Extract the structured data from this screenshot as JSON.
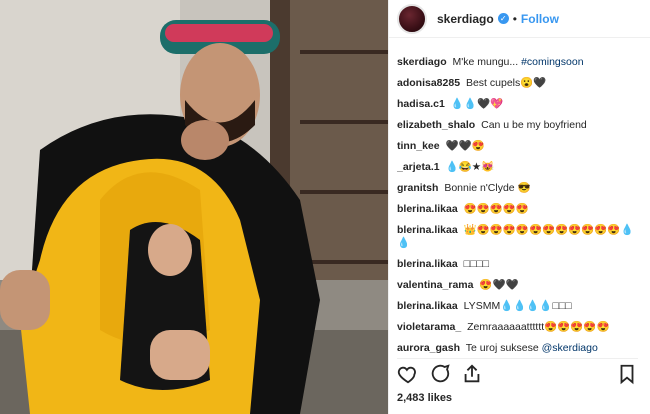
{
  "post": {
    "author": "skerdiago",
    "follow_label": "Follow",
    "verified_icon": "✓",
    "likes_text": "2,483 likes"
  },
  "comments": [
    {
      "user": "skerdiago",
      "text": "M'ke mungu...",
      "tag": "#comingsoon"
    },
    {
      "user": "adonisa8285",
      "text": "Best cupels😮🖤"
    },
    {
      "user": "hadisa.c1",
      "text": "💧💧🖤💖"
    },
    {
      "user": "elizabeth_shalo",
      "text": "Can u be my boyfriend"
    },
    {
      "user": "tinn_kee",
      "text": "🖤🖤😍"
    },
    {
      "user": "_arjeta.1",
      "text": "💧😂★😻"
    },
    {
      "user": "granitsh",
      "text": "Bonnie n'Clyde 😎"
    },
    {
      "user": "blerina.likaa",
      "text": "😍😍😍😍😍"
    },
    {
      "user": "blerina.likaa",
      "text": "👑😍😍😍😍😍😍😍😍😍😍😍💧💧"
    },
    {
      "user": "blerina.likaa",
      "text": "□□□□"
    },
    {
      "user": "valentina_rama",
      "text": "😍🖤🖤"
    },
    {
      "user": "blerina.likaa",
      "text": "LYSMM💧💧💧💧□□□"
    },
    {
      "user": "violetarama_",
      "text": "Zemraaaaaatttttt😍😍😍😍😍"
    },
    {
      "user": "aurora_gash",
      "text": "Te uroj suksese",
      "tag": "@skerdiago"
    }
  ],
  "icons": {
    "like": "heart-icon",
    "comment": "comment-icon",
    "share": "share-icon",
    "save": "bookmark-icon"
  }
}
